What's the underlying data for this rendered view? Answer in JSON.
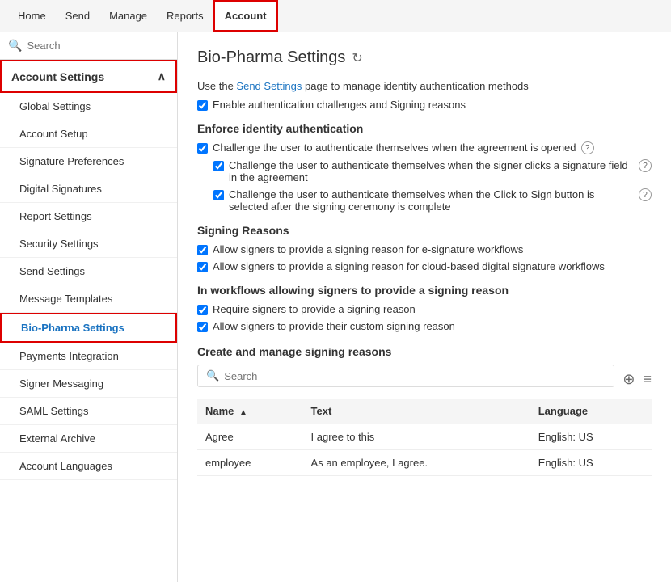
{
  "topNav": {
    "items": [
      {
        "label": "Home",
        "active": false
      },
      {
        "label": "Send",
        "active": false
      },
      {
        "label": "Manage",
        "active": false
      },
      {
        "label": "Reports",
        "active": false
      },
      {
        "label": "Account",
        "active": true
      }
    ]
  },
  "sidebar": {
    "searchPlaceholder": "Search",
    "sectionHeader": "Account Settings",
    "items": [
      {
        "label": "Global Settings",
        "active": false
      },
      {
        "label": "Account Setup",
        "active": false
      },
      {
        "label": "Signature Preferences",
        "active": false
      },
      {
        "label": "Digital Signatures",
        "active": false
      },
      {
        "label": "Report Settings",
        "active": false
      },
      {
        "label": "Security Settings",
        "active": false
      },
      {
        "label": "Send Settings",
        "active": false
      },
      {
        "label": "Message Templates",
        "active": false
      },
      {
        "label": "Bio-Pharma Settings",
        "active": true
      },
      {
        "label": "Payments Integration",
        "active": false
      },
      {
        "label": "Signer Messaging",
        "active": false
      },
      {
        "label": "SAML Settings",
        "active": false
      },
      {
        "label": "External Archive",
        "active": false
      },
      {
        "label": "Account Languages",
        "active": false
      }
    ]
  },
  "main": {
    "title": "Bio-Pharma Settings",
    "descriptionText": "Use the ",
    "descriptionLink": "Send Settings",
    "descriptionRest": " page to manage identity authentication methods",
    "topCheckbox": "Enable authentication challenges and Signing reasons",
    "enforceSection": {
      "heading": "Enforce identity authentication",
      "checkboxes": [
        {
          "label": "Challenge the user to authenticate themselves when the agreement is opened",
          "hasHelp": true,
          "indent": 0
        },
        {
          "label": "Challenge the user to authenticate themselves when the signer clicks a signature field in the agreement",
          "hasHelp": true,
          "indent": 1
        },
        {
          "label": "Challenge the user to authenticate themselves when the Click to Sign button is selected after the signing ceremony is complete",
          "hasHelp": true,
          "indent": 1
        }
      ]
    },
    "signingReasonsSection": {
      "heading": "Signing Reasons",
      "checkboxes": [
        {
          "label": "Allow signers to provide a signing reason for e-signature workflows",
          "hasHelp": false
        },
        {
          "label": "Allow signers to provide a signing reason for cloud-based digital signature workflows",
          "hasHelp": false
        }
      ]
    },
    "workflowsSection": {
      "heading": "In workflows allowing signers to provide a signing reason",
      "checkboxes": [
        {
          "label": "Require signers to provide a signing reason",
          "hasHelp": false
        },
        {
          "label": "Allow signers to provide their custom signing reason",
          "hasHelp": false
        }
      ]
    },
    "tableSection": {
      "heading": "Create and manage signing reasons",
      "searchPlaceholder": "Search",
      "columns": [
        {
          "label": "Name",
          "sortable": true
        },
        {
          "label": "Text",
          "sortable": false
        },
        {
          "label": "Language",
          "sortable": false
        }
      ],
      "rows": [
        {
          "name": "Agree",
          "text": "I agree to this",
          "language": "English: US"
        },
        {
          "name": "employee",
          "text": "As an employee, I agree.",
          "language": "English: US"
        }
      ]
    }
  },
  "icons": {
    "search": "🔍",
    "refresh": "↻",
    "chevronUp": "∧",
    "plus": "⊕",
    "menu": "≡",
    "helpChar": "?"
  }
}
